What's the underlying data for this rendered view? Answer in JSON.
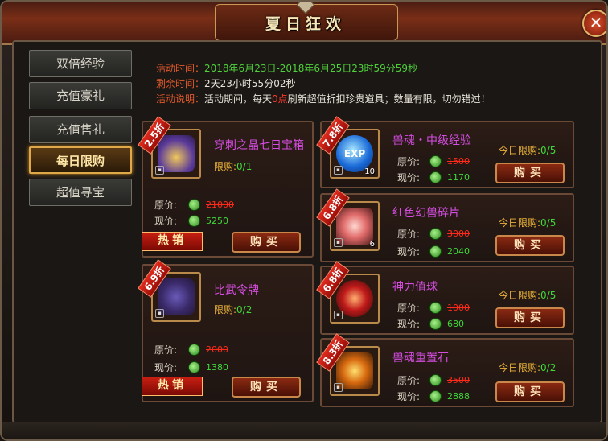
{
  "window": {
    "title": "夏日狂欢",
    "close_label": "✕"
  },
  "sidebar": {
    "items": [
      {
        "label": "双倍经验",
        "active": false
      },
      {
        "label": "充值豪礼",
        "active": false
      },
      {
        "label": "充值售礼",
        "active": false
      },
      {
        "label": "每日限购",
        "active": true
      },
      {
        "label": "超值寻宝",
        "active": false
      }
    ]
  },
  "info": {
    "time_label": "活动时间：",
    "time_value": "2018年6月23日-2018年6月25日23时59分59秒",
    "remain_label": "剩余时间：",
    "remain_value": "2天23小时55分02秒",
    "desc_label": "活动说明：",
    "desc_part1": "活动期间，每天",
    "desc_highlight": "0点",
    "desc_part2": "刷新超值折扣珍贵道具；数量有限，切勿错过！"
  },
  "labels": {
    "orig_price": "原价:",
    "now_price": "现价:",
    "buy": "购买",
    "hot": "热销",
    "daily_limit": "今日限购:",
    "limit": "限购:"
  },
  "big_items": [
    {
      "discount": "2.5折",
      "name": "穿刺之晶七日宝箱",
      "limit": "0/1",
      "orig": "21000",
      "now": "5250",
      "hot": true
    },
    {
      "discount": "6.9折",
      "name": "比武令牌",
      "limit": "0/2",
      "orig": "2000",
      "now": "1380",
      "hot": true
    }
  ],
  "small_items": [
    {
      "discount": "7.8折",
      "name": "兽魂・中级经验",
      "limit": "0/5",
      "orig": "1500",
      "now": "1170",
      "count": "10",
      "icon": "exp-orb-icon"
    },
    {
      "discount": "6.8折",
      "name": "红色幻兽碎片",
      "limit": "0/5",
      "orig": "3000",
      "now": "2040",
      "count": "6",
      "icon": "beast-shard-icon"
    },
    {
      "discount": "6.8折",
      "name": "神力值球",
      "limit": "0/5",
      "orig": "1000",
      "now": "680",
      "count": "",
      "icon": "power-orb-icon"
    },
    {
      "discount": "8.3折",
      "name": "兽魂重置石",
      "limit": "0/2",
      "orig": "3500",
      "now": "2888",
      "count": "",
      "icon": "reset-stone-icon"
    }
  ]
}
